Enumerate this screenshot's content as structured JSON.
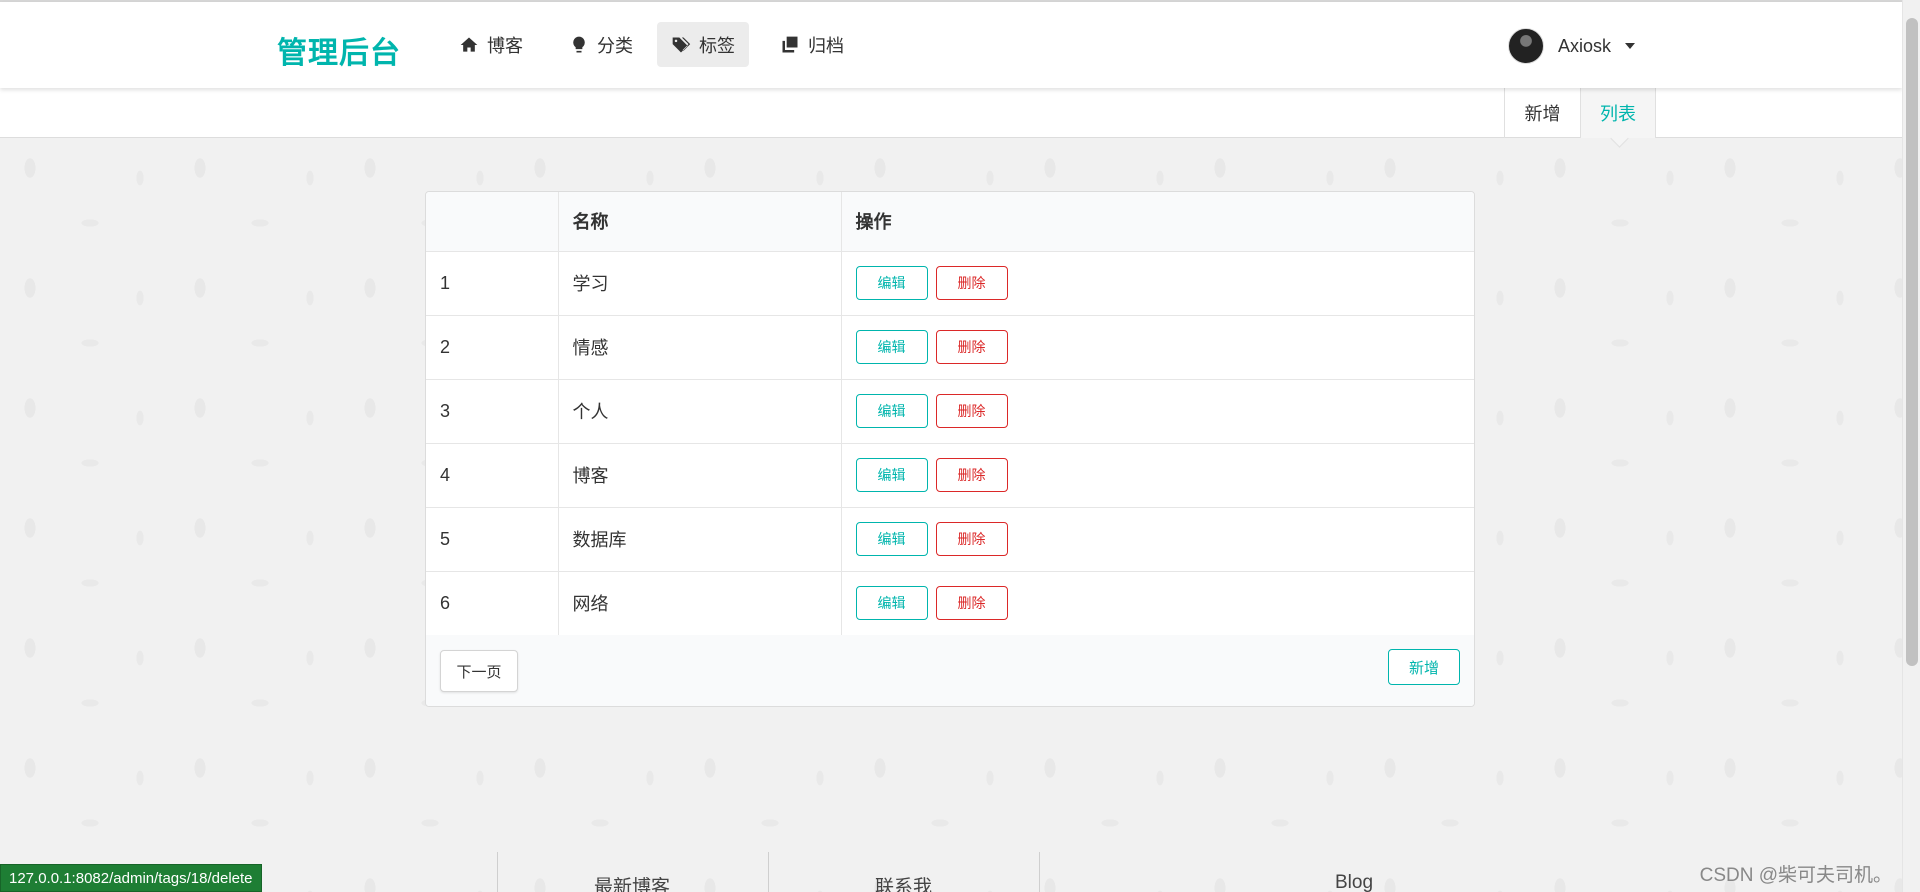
{
  "header": {
    "brand": "管理后台",
    "nav": [
      {
        "label": "博客",
        "icon": "home-icon"
      },
      {
        "label": "分类",
        "icon": "lightbulb-icon"
      },
      {
        "label": "标签",
        "icon": "tags-icon",
        "active": true
      },
      {
        "label": "归档",
        "icon": "clone-icon"
      }
    ],
    "user": {
      "name": "Axiosk"
    }
  },
  "subnav": {
    "add_label": "新增",
    "list_label": "列表",
    "active": "列表"
  },
  "table": {
    "columns": [
      "",
      "名称",
      "操作"
    ],
    "rows": [
      {
        "id": "1",
        "name": "学习"
      },
      {
        "id": "2",
        "name": "情感"
      },
      {
        "id": "3",
        "name": "个人"
      },
      {
        "id": "4",
        "name": "博客"
      },
      {
        "id": "5",
        "name": "数据库"
      },
      {
        "id": "6",
        "name": "网络"
      }
    ],
    "edit_label": "编辑",
    "delete_label": "删除",
    "next_page_label": "下一页",
    "add_label": "新增"
  },
  "footer": {
    "columns": [
      "最新博客",
      "联系我",
      "Blog"
    ]
  },
  "status_url": "127.0.0.1:8082/admin/tags/18/delete",
  "watermark": "CSDN @柴可夫司机。",
  "colors": {
    "accent": "#00b5ad",
    "danger": "#db2828",
    "status_bar": "#1e7e34"
  }
}
